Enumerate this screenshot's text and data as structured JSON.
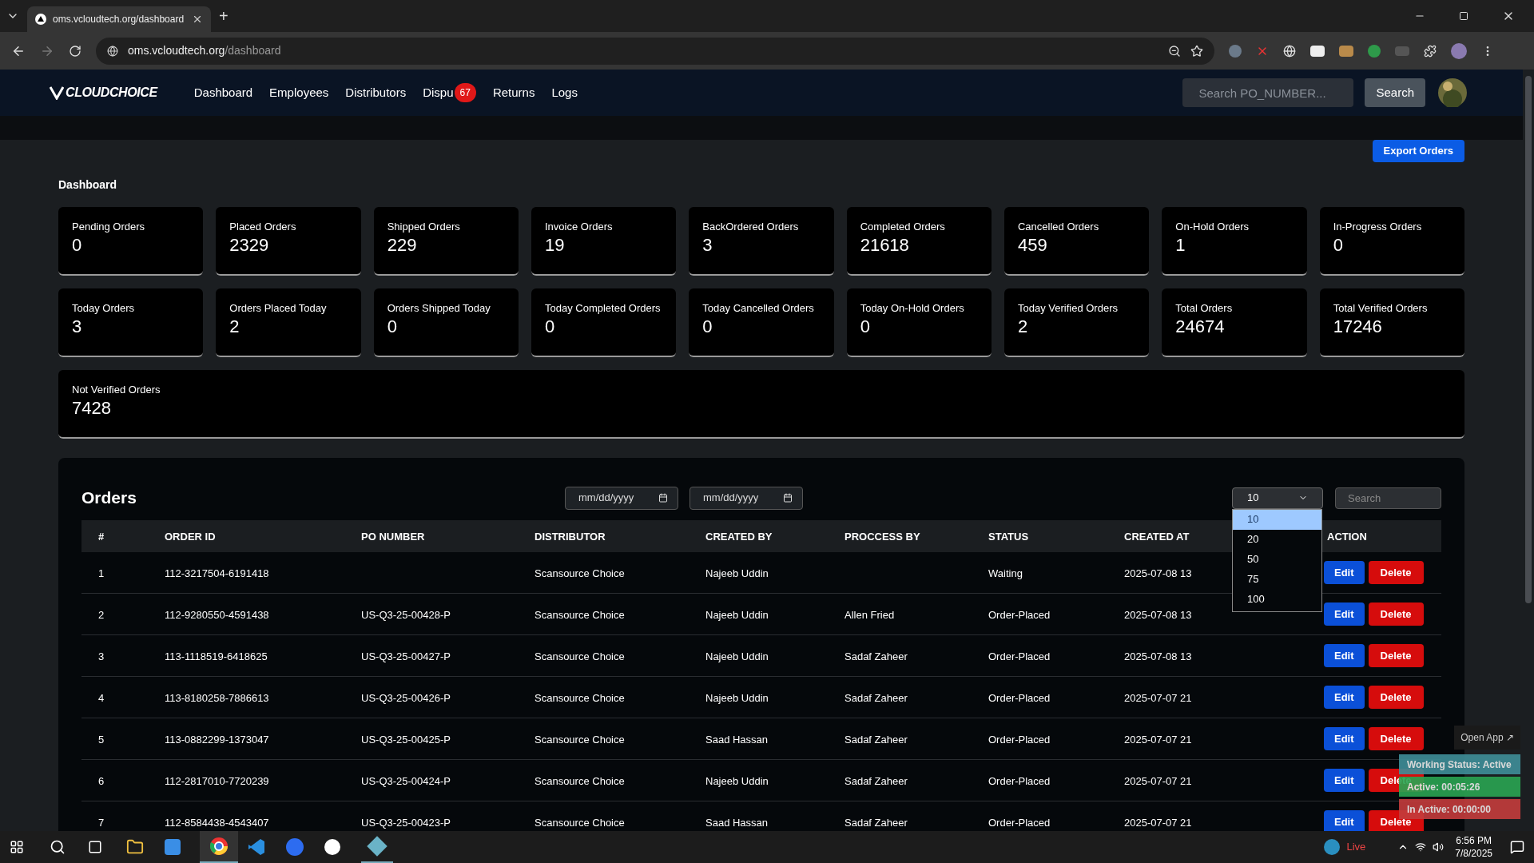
{
  "browser": {
    "tab_title": "oms.vcloudtech.org/dashboard",
    "new_tab": "+",
    "url_host": "oms.vcloudtech.org",
    "url_path": "/dashboard"
  },
  "nav": {
    "logo": "CLOUDCHOICE",
    "links": [
      {
        "label": "Dashboard"
      },
      {
        "label": "Employees"
      },
      {
        "label": "Distributors"
      },
      {
        "label": "Dispu",
        "badge": "67"
      },
      {
        "label": "Returns"
      },
      {
        "label": "Logs"
      }
    ],
    "search": {
      "placeholder": "Search PO_NUMBER..."
    },
    "search_button": "Search"
  },
  "export_button": "Export Orders",
  "dashboard": {
    "title": "Dashboard",
    "rows": [
      [
        {
          "label": "Pending Orders",
          "value": "0"
        },
        {
          "label": "Placed Orders",
          "value": "2329"
        },
        {
          "label": "Shipped Orders",
          "value": "229"
        },
        {
          "label": "Invoice Orders",
          "value": "19"
        },
        {
          "label": "BackOrdered Orders",
          "value": "3"
        },
        {
          "label": "Completed Orders",
          "value": "21618"
        },
        {
          "label": "Cancelled Orders",
          "value": "459"
        },
        {
          "label": "On-Hold Orders",
          "value": "1"
        },
        {
          "label": "In-Progress Orders",
          "value": "0"
        }
      ],
      [
        {
          "label": "Today Orders",
          "value": "3"
        },
        {
          "label": "Orders Placed Today",
          "value": "2"
        },
        {
          "label": "Orders Shipped Today",
          "value": "0"
        },
        {
          "label": "Today Completed Orders",
          "value": "0"
        },
        {
          "label": "Today Cancelled Orders",
          "value": "0"
        },
        {
          "label": "Today On-Hold Orders",
          "value": "0"
        },
        {
          "label": "Today Verified Orders",
          "value": "2"
        },
        {
          "label": "Total Orders",
          "value": "24674"
        },
        {
          "label": "Total Verified Orders",
          "value": "17246"
        }
      ],
      [
        {
          "label": "Not Verified Orders",
          "value": "7428"
        }
      ]
    ]
  },
  "orders": {
    "title": "Orders",
    "date_fields": [
      {
        "placeholder": "mm/dd/yyyy"
      },
      {
        "placeholder": "mm/dd/yyyy"
      }
    ],
    "page_size": {
      "value": "10",
      "options": [
        {
          "label": "10",
          "selected": true
        },
        {
          "label": "20",
          "selected": false
        },
        {
          "label": "50",
          "selected": false
        },
        {
          "label": "75",
          "selected": false
        },
        {
          "label": "100",
          "selected": false
        }
      ]
    },
    "search": {
      "placeholder": "Search"
    },
    "columns": [
      "#",
      "ORDER ID",
      "PO NUMBER",
      "DISTRIBUTOR",
      "CREATED BY",
      "PROCCESS BY",
      "STATUS",
      "CREATED AT",
      "ACTION"
    ],
    "rows": [
      {
        "num": "1",
        "order_id": "112-3217504-6191418",
        "distributor": "Scansource Choice",
        "created_by": "Najeeb Uddin",
        "status": "Waiting",
        "created_at": "2025-07-08 13",
        "actions": [
          "Edit",
          "Delete"
        ]
      },
      {
        "num": "2",
        "order_id": "112-9280550-4591438",
        "po_number": "US-Q3-25-00428-P",
        "distributor": "Scansource Choice",
        "created_by": "Najeeb Uddin",
        "process_by": "Allen Fried",
        "status": "Order-Placed",
        "created_at": "2025-07-08 13",
        "actions": [
          "Edit",
          "Delete"
        ]
      },
      {
        "num": "3",
        "order_id": "113-1118519-6418625",
        "po_number": "US-Q3-25-00427-P",
        "distributor": "Scansource Choice",
        "created_by": "Najeeb Uddin",
        "process_by": "Sadaf Zaheer",
        "status": "Order-Placed",
        "created_at": "2025-07-08 13",
        "actions": [
          "Edit",
          "Delete"
        ]
      },
      {
        "num": "4",
        "order_id": "113-8180258-7886613",
        "po_number": "US-Q3-25-00426-P",
        "distributor": "Scansource Choice",
        "created_by": "Najeeb Uddin",
        "process_by": "Sadaf Zaheer",
        "status": "Order-Placed",
        "created_at": "2025-07-07 21",
        "actions": [
          "Edit",
          "Delete"
        ]
      },
      {
        "num": "5",
        "order_id": "113-0882299-1373047",
        "po_number": "US-Q3-25-00425-P",
        "distributor": "Scansource Choice",
        "created_by": "Saad Hassan",
        "process_by": "Sadaf Zaheer",
        "status": "Order-Placed",
        "created_at": "2025-07-07 21",
        "actions": [
          "Edit",
          "Delete"
        ]
      },
      {
        "num": "6",
        "order_id": "112-2817010-7720239",
        "po_number": "US-Q3-25-00424-P",
        "distributor": "Scansource Choice",
        "created_by": "Najeeb Uddin",
        "process_by": "Sadaf Zaheer",
        "status": "Order-Placed",
        "created_at": "2025-07-07 21",
        "actions": [
          "Edit",
          "Delete"
        ]
      },
      {
        "num": "7",
        "order_id": "112-8584438-4543407",
        "po_number": "US-Q3-25-00423-P",
        "distributor": "Scansource Choice",
        "created_by": "Saad Hassan",
        "process_by": "Sadaf Zaheer",
        "status": "Order-Placed",
        "created_at": "2025-07-07 21",
        "actions": [
          "Edit",
          "Delete"
        ]
      }
    ]
  },
  "tracker": {
    "open_app": "Open App ↗",
    "lines": [
      {
        "kind": "status",
        "text": "Working Status: Active"
      },
      {
        "kind": "active",
        "text": "Active: 00:05:26"
      },
      {
        "kind": "inactive",
        "text": "In Active: 00:00:00"
      }
    ]
  },
  "taskbar": {
    "weather": "Live",
    "time": "6:56 PM",
    "date": "7/8/2025"
  }
}
